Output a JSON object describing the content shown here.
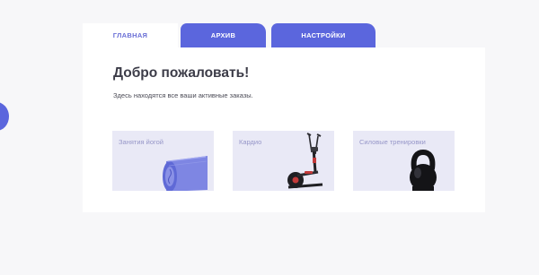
{
  "tabs": [
    {
      "label": "ГЛАВНАЯ",
      "active": true
    },
    {
      "label": "АРХИВ",
      "active": false
    },
    {
      "label": "НАСТРОЙКИ",
      "active": false
    }
  ],
  "main": {
    "title": "Добро пожаловать!",
    "subtitle": "Здесь находятся все ваши активные заказы."
  },
  "cards": [
    {
      "label": "Занятия йогой",
      "image": "yoga-mat-icon"
    },
    {
      "label": "Кардио",
      "image": "elliptical-trainer-icon"
    },
    {
      "label": "Силовые тренировки",
      "image": "kettlebell-icon"
    }
  ],
  "colors": {
    "accent": "#5b66dd",
    "card_bg": "#e9e9f6",
    "card_label": "#9696c8",
    "page_bg": "#f7f7f9"
  }
}
